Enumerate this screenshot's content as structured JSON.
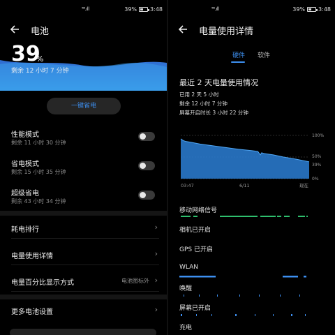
{
  "status_bar": {
    "signal": "⁵⁶.ıll",
    "battery": "39%",
    "time": "3:48"
  },
  "left": {
    "title": "电池",
    "percent": "39",
    "percent_sign": "%",
    "remaining": "剩余 12 小时 7 分钟",
    "saver_button": "一键省电",
    "modes": [
      {
        "name": "性能模式",
        "desc": "剩余 11 小时 30 分钟",
        "on": false
      },
      {
        "name": "省电模式",
        "desc": "剩余 15 小时 35 分钟",
        "on": false
      },
      {
        "name": "超级省电",
        "desc": "剩余 43 小时 34 分钟",
        "on": false
      }
    ],
    "rows": [
      {
        "label": "耗电排行",
        "value": ""
      },
      {
        "label": "电量使用详情",
        "value": ""
      },
      {
        "label": "电量百分比显示方式",
        "value": "电池图标外"
      },
      {
        "label": "更多电池设置",
        "value": ""
      }
    ],
    "chevron": "›",
    "colors": {
      "accent": "#3d8ff0",
      "hero_top": "#2f6bd0",
      "hero_bottom": "#3aa0ee"
    }
  },
  "right": {
    "title": "电量使用详情",
    "tabs": [
      "硬件",
      "软件"
    ],
    "usage_title": "最近 2 天电量使用情况",
    "stats": [
      "已用 2 天 5 小时",
      "剩余 12 小时 7 分钟",
      "屏幕开启时长 3 小时 22 分钟"
    ],
    "chart_data": {
      "type": "area",
      "x_ticks": [
        "03:47",
        "6/11",
        "现在"
      ],
      "y_ticks": [
        "100%",
        "50%",
        "39%",
        "0%"
      ],
      "ylim": [
        0,
        100
      ],
      "x": [
        0,
        2,
        4,
        8,
        15,
        25,
        35,
        45,
        55,
        60,
        62,
        63,
        65,
        72,
        80,
        90,
        100
      ],
      "values": [
        92,
        88,
        86,
        84,
        80,
        76,
        72,
        68,
        65,
        63,
        55,
        60,
        58,
        55,
        50,
        45,
        39
      ],
      "colors": {
        "fill": "#2b7fd6",
        "line": "#4fa6f5"
      }
    },
    "hardware_items": [
      "移动网络信号",
      "相机已开启",
      "GPS 已开启",
      "WLAN",
      "唤醒",
      "屏幕已开启",
      "充电"
    ]
  }
}
